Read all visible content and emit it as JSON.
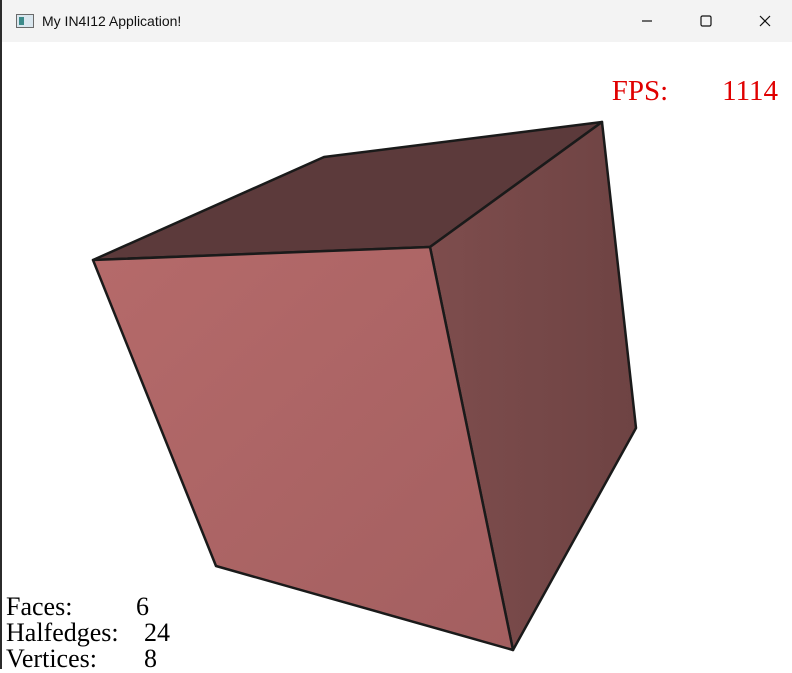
{
  "window": {
    "title": "My IN4I12 Application!",
    "icon": "app-window-icon",
    "controls": [
      "minimize-icon",
      "maximize-icon",
      "close-icon"
    ]
  },
  "overlay": {
    "fps_label": "FPS:",
    "fps_value": "1114",
    "fps_color": "#e00000"
  },
  "stats": {
    "faces_label": "Faces:",
    "faces_value": "6",
    "halfedges_label": "Halfedges:",
    "halfedges_value": "24",
    "vertices_label": "Vertices:",
    "vertices_value": "8"
  },
  "scene": {
    "object": "cube",
    "colors": {
      "front": "#b06868",
      "right": "#7a4a4a",
      "top": "#5c3a3a",
      "edge": "#1a1a1a"
    }
  }
}
